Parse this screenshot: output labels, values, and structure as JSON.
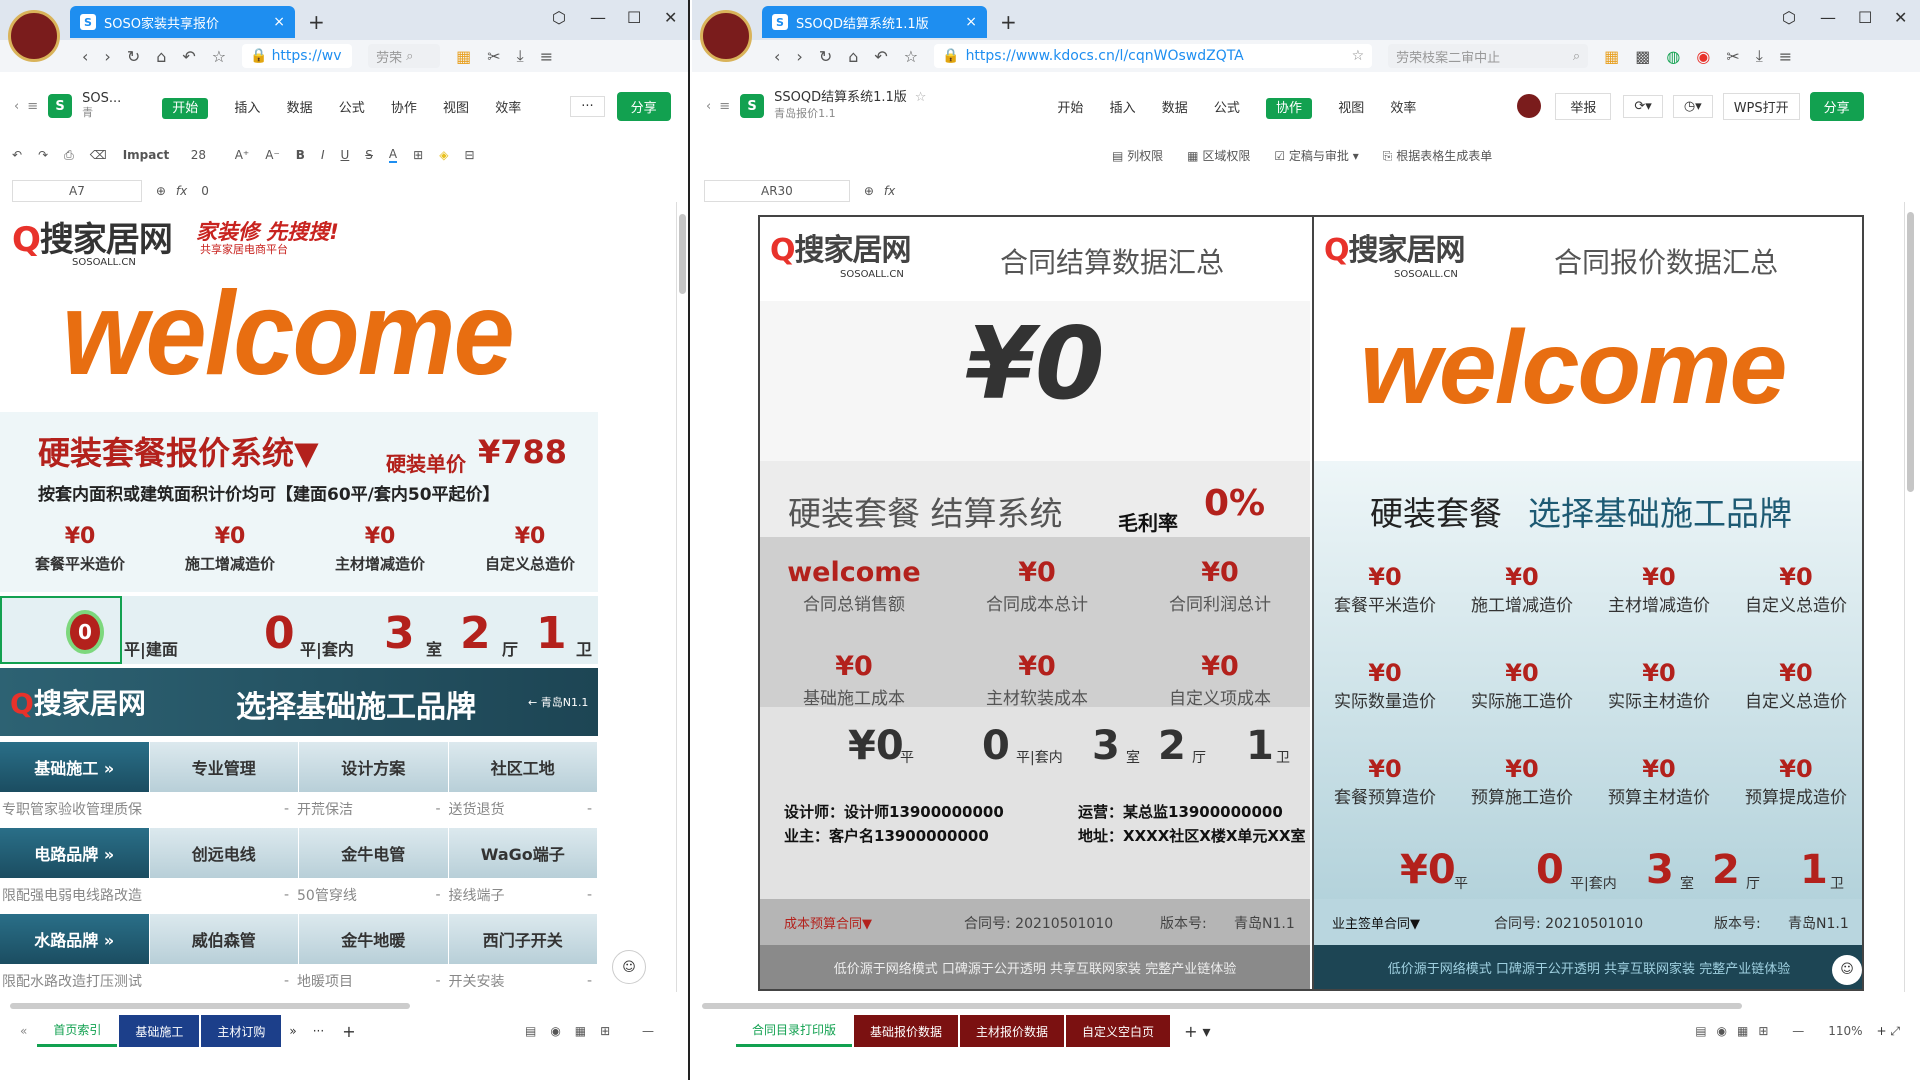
{
  "left": {
    "tab_title": "SOSO家装共享报价",
    "url": "https://wv",
    "search": "劳荣",
    "doc_title": "SOS...",
    "folder": "青",
    "menu": [
      "开始",
      "插入",
      "数据",
      "公式",
      "协作",
      "视图",
      "效率"
    ],
    "share": "分享",
    "more": "···",
    "font_name": "Impact",
    "font_size": "28",
    "cell_ref": "A7",
    "formula": "0",
    "brand_main": "搜家居网",
    "brand_q": "Q",
    "brand_sub": "SOSOALL.CN",
    "slogan": "家装修 先搜搜!",
    "slogan_sub": "共享家居电商平台",
    "welcome": "welcome",
    "system_title": "硬装套餐报价系统▼",
    "unit_label": "硬装单价",
    "unit_price": "¥788",
    "note": "按套内面积或建筑面积计价均可【建面60平/套内50平起价】",
    "prices": [
      {
        "v": "¥0",
        "l": "套餐平米造价"
      },
      {
        "v": "¥0",
        "l": "施工增减造价"
      },
      {
        "v": "¥0",
        "l": "主材增减造价"
      },
      {
        "v": "¥0",
        "l": "自定义总造价"
      }
    ],
    "area": {
      "build": "0",
      "build_label": "平|建面",
      "inner": "0",
      "inner_label": "平|套内",
      "rooms": "3",
      "room_l": "室",
      "halls": "2",
      "hall_l": "厅",
      "baths": "1",
      "bath_l": "卫"
    },
    "band_title": "选择基础施工品牌",
    "band_back": "← 青岛N1.1",
    "rows": [
      {
        "h": "基础施工 »",
        "c": [
          "专业管理",
          "设计方案",
          "社区工地"
        ],
        "s": [
          "专职管家验收管理质保",
          "-",
          "开荒保洁",
          "-",
          "送货退货",
          "-"
        ]
      },
      {
        "h": "电路品牌 »",
        "c": [
          "创远电线",
          "金牛电管",
          "WaGo端子"
        ],
        "s": [
          "限配强电弱电线路改造",
          "-",
          "50管穿线",
          "-",
          "接线端子",
          "-"
        ]
      },
      {
        "h": "水路品牌 »",
        "c": [
          "威伯森管",
          "金牛地暖",
          "西门子开关"
        ],
        "s": [
          "限配水路改造打压测试",
          "-",
          "地暖项目",
          "-",
          "开关安装",
          "-"
        ]
      }
    ],
    "sheet_tabs": [
      "首页索引",
      "基础施工",
      "主材订购"
    ],
    "sheet_more": "»",
    "sheet_dots": "···"
  },
  "right": {
    "tab_title": "SSOQD结算系统1.1版",
    "url": "https://www.kdocs.cn/l/cqnWOswdZQTA",
    "search": "劳荣枝案二审中止",
    "doc_title": "SSOQD结算系统1.1版",
    "folder": "青岛报价1.1",
    "menu": [
      "开始",
      "插入",
      "数据",
      "公式",
      "协作",
      "视图",
      "效率"
    ],
    "report": "举报",
    "wps_open": "WPS打开",
    "share": "分享",
    "ribbon": [
      "列权限",
      "区域权限",
      "定稿与审批",
      "根据表格生成表单"
    ],
    "cell_ref": "AR30",
    "brand_main": "搜家居网",
    "brand_q": "Q",
    "brand_sub": "SOSOALL.CN",
    "left_panel": {
      "title": "合同结算数据汇总",
      "big": "¥0",
      "system": "硬装套餐  结算系统",
      "margin_label": "毛利率",
      "margin": "0%",
      "metrics": [
        {
          "v": "welcome",
          "l": "合同总销售额"
        },
        {
          "v": "¥0",
          "l": "合同成本总计"
        },
        {
          "v": "¥0",
          "l": "合同利润总计"
        },
        {
          "v": "¥0",
          "l": "基础施工成本"
        },
        {
          "v": "¥0",
          "l": "主材软装成本"
        },
        {
          "v": "¥0",
          "l": "自定义项成本"
        }
      ],
      "area": {
        "v": "¥0",
        "u": "平",
        "inner": "0",
        "inner_l": "平|套内",
        "rooms": "3",
        "room_l": "室",
        "halls": "2",
        "hall_l": "厅",
        "baths": "1",
        "bath_l": "卫"
      },
      "designer": "设计师：设计师13900000000",
      "ops": "运营：某总监13900000000",
      "owner": "业主：客户名13900000000",
      "addr": "地址：XXXX社区X楼X单元XX室",
      "contract_type": "成本预算合同▼",
      "contract_no": "合同号: 20210501010",
      "version_label": "版本号:",
      "version": "青岛N1.1",
      "footer": "低价源于网络模式 口碑源于公开透明 共享互联网家装 完整产业链体验"
    },
    "right_panel": {
      "title": "合同报价数据汇总",
      "welcome": "welcome",
      "system_a": "硬装套餐",
      "system_b": "选择基础施工品牌",
      "metrics": [
        {
          "v": "¥0",
          "l": "套餐平米造价"
        },
        {
          "v": "¥0",
          "l": "施工增减造价"
        },
        {
          "v": "¥0",
          "l": "主材增减造价"
        },
        {
          "v": "¥0",
          "l": "自定义总造价"
        },
        {
          "v": "¥0",
          "l": "实际数量造价"
        },
        {
          "v": "¥0",
          "l": "实际施工造价"
        },
        {
          "v": "¥0",
          "l": "实际主材造价"
        },
        {
          "v": "¥0",
          "l": "自定义总造价"
        },
        {
          "v": "¥0",
          "l": "套餐预算造价"
        },
        {
          "v": "¥0",
          "l": "预算施工造价"
        },
        {
          "v": "¥0",
          "l": "预算主材造价"
        },
        {
          "v": "¥0",
          "l": "预算提成造价"
        }
      ],
      "area": {
        "v": "¥0",
        "u": "平",
        "inner": "0",
        "inner_l": "平|套内",
        "rooms": "3",
        "room_l": "室",
        "halls": "2",
        "hall_l": "厅",
        "baths": "1",
        "bath_l": "卫"
      },
      "contract_type": "业主签单合同▼",
      "contract_no": "合同号: 20210501010",
      "version_label": "版本号:",
      "version": "青岛N1.1",
      "footer": "低价源于网络模式 口碑源于公开透明 共享互联网家装 完整产业链体验"
    },
    "sheet_tabs": [
      "合同目录打印版",
      "基础报价数据",
      "主材报价数据",
      "自定义空白页"
    ],
    "zoom": "110%"
  },
  "colors": {
    "orange": "#e86e11",
    "red": "#b3211c",
    "green": "#12a150",
    "teal": "#1d4554"
  }
}
